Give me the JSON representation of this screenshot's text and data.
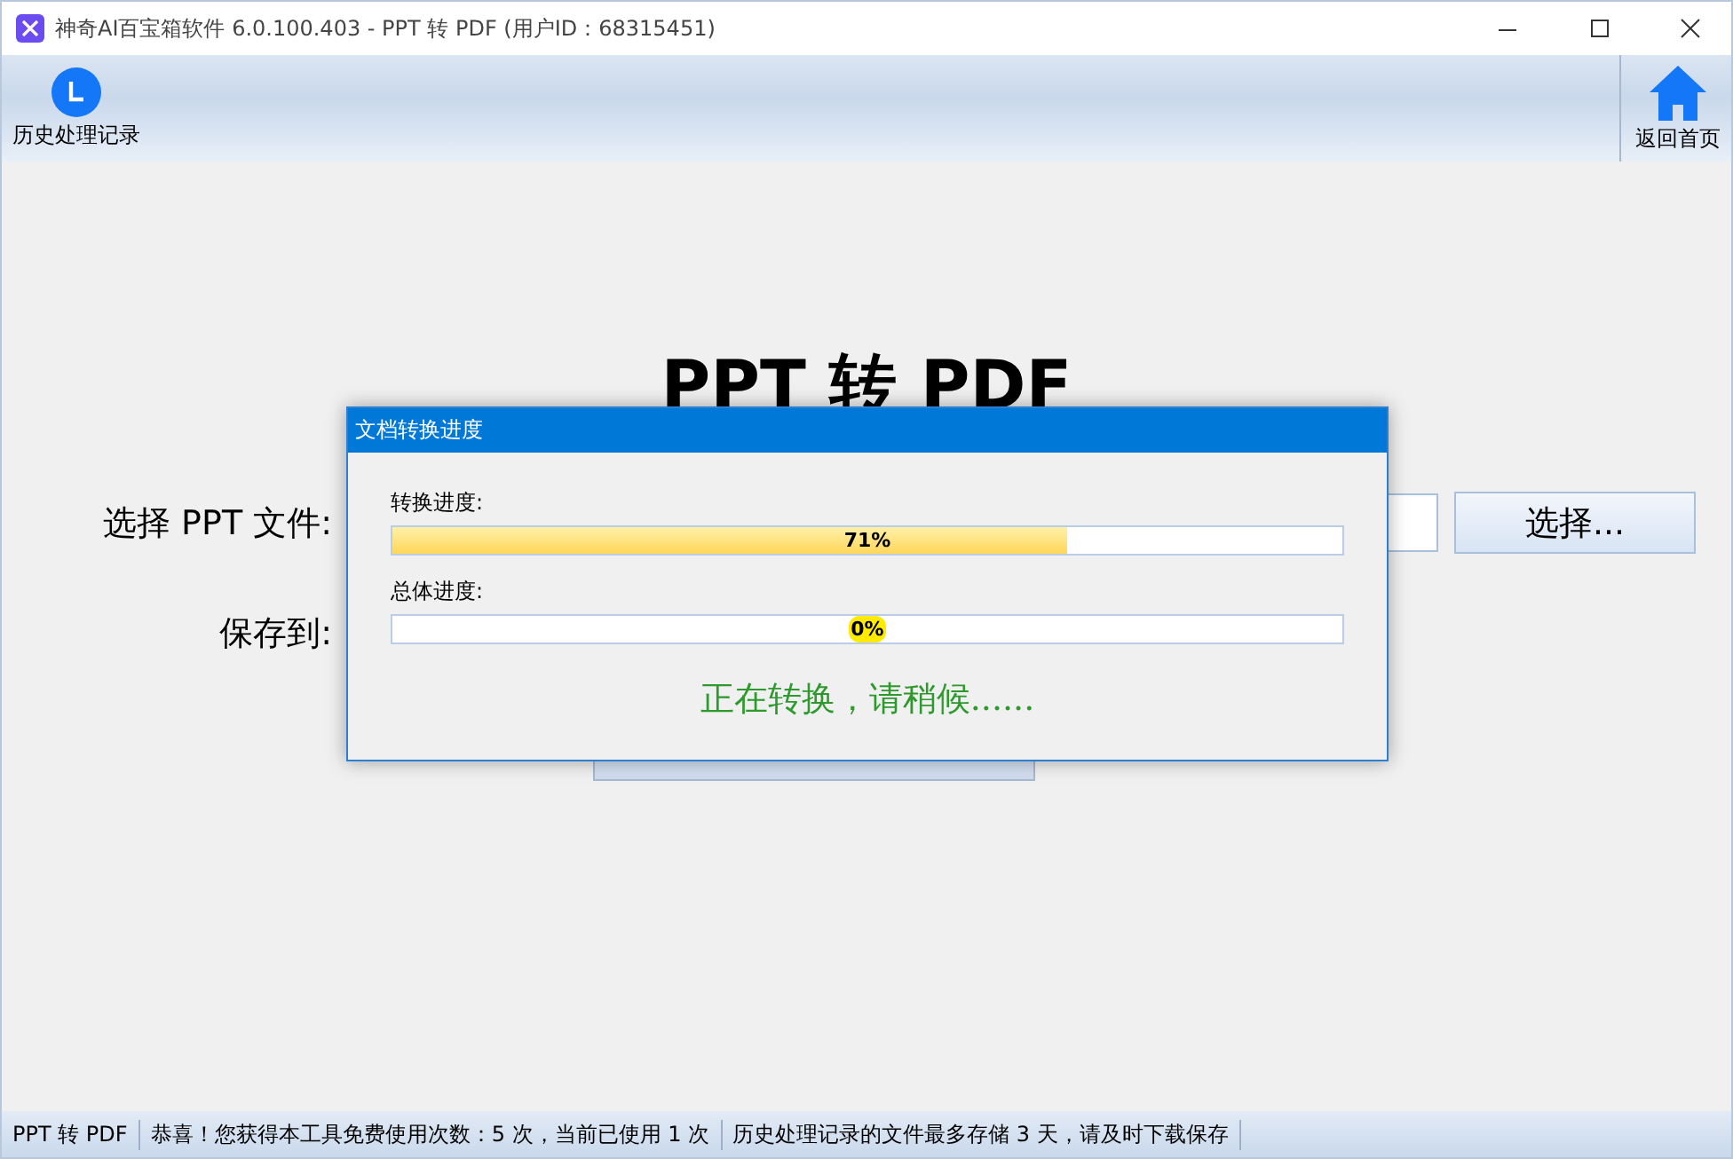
{
  "window": {
    "title": "神奇AI百宝箱软件 6.0.100.403 - PPT 转 PDF (用户ID：68315451)"
  },
  "toolbar": {
    "left": {
      "label": "历史处理记录"
    },
    "right": {
      "label": "返回首页"
    }
  },
  "main": {
    "heading": "PPT 转 PDF",
    "rows": [
      {
        "kind": "file",
        "label": "选择 PPT 文件:",
        "button": "选择..."
      },
      {
        "kind": "save",
        "label": "保存到:"
      }
    ]
  },
  "dialog": {
    "title": "文档转换进度",
    "progress": [
      {
        "label": "转换进度:",
        "level": 0.71,
        "reading": "71%"
      },
      {
        "label": "总体进度:",
        "level": 0,
        "reading": "0%"
      }
    ],
    "message": "正在转换，请稍候......"
  },
  "status_bar": [
    "PPT 转 PDF",
    "恭喜！您获得本工具免费使用次数：5 次，当前已使用 1 次",
    "历史处理记录的文件最多存储 3 天，请及时下载保存"
  ]
}
